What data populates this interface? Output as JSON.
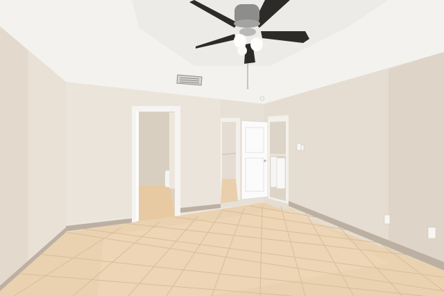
{
  "scene": {
    "type": "empty-bedroom-interior",
    "elements": [
      "ceiling",
      "ceiling-fan",
      "hvac-vent",
      "left-wall",
      "back-wall",
      "right-wall",
      "bathroom-doorway",
      "closet-doorway",
      "open-door",
      "laundry-doorway",
      "washer",
      "dryer",
      "tile-floor",
      "baseboards",
      "electrical-outlets",
      "light-switch"
    ]
  },
  "colors": {
    "ceiling": "#f2f1ee",
    "wall_light": "#ece5db",
    "wall_shadow": "#dcd2c4",
    "floor_tile": "#ead2b2",
    "grout": "#d7bc98",
    "baseboard": "#b9ada0",
    "door": "#fafafa",
    "fan_blade": "#2d2b29",
    "fan_hub": "#8f8f8f"
  }
}
